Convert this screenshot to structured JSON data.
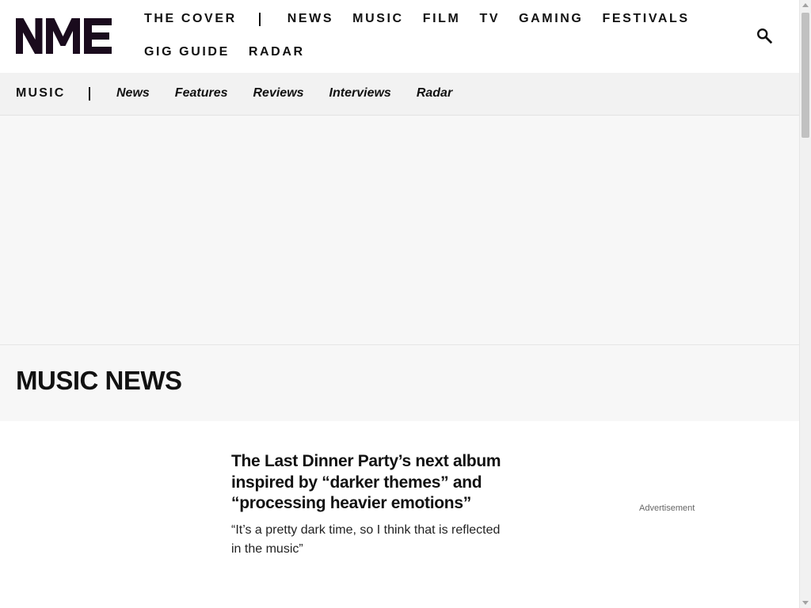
{
  "brand": {
    "logo_text": "NME",
    "colors": {
      "logo": "#1a0b1d",
      "text": "#111111",
      "subnav_bg": "#f2f2f2",
      "panel_bg": "#f7f7f7"
    }
  },
  "nav": {
    "row1": [
      "THE COVER",
      "NEWS",
      "MUSIC",
      "FILM",
      "TV",
      "GAMING",
      "FESTIVALS"
    ],
    "row2": [
      "GIG GUIDE",
      "RADAR"
    ],
    "search_icon": "search-icon"
  },
  "subnav": {
    "title": "MUSIC",
    "items": [
      "News",
      "Features",
      "Reviews",
      "Interviews",
      "Radar"
    ]
  },
  "section": {
    "title": "MUSIC NEWS"
  },
  "article": {
    "title": "The Last Dinner Party’s next album inspired by “darker themes” and “processing heavier emotions”",
    "excerpt": "“It’s a pretty dark time, so I think that is reflected in the music”"
  },
  "ad": {
    "label": "Advertisement"
  }
}
